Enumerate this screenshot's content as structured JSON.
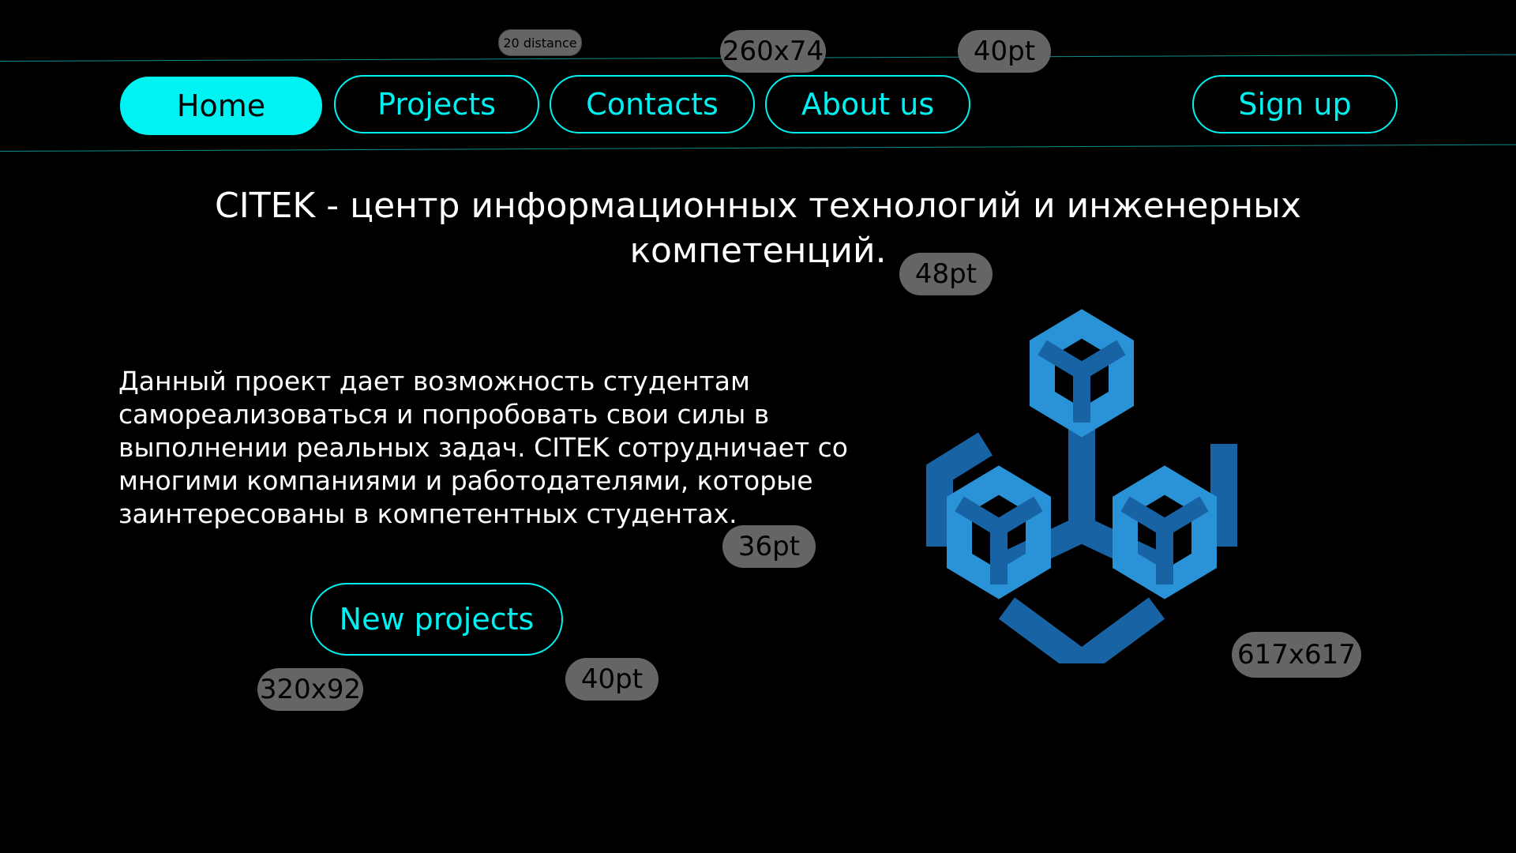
{
  "nav": {
    "items": [
      {
        "label": "Home"
      },
      {
        "label": "Projects"
      },
      {
        "label": "Contacts"
      },
      {
        "label": "About us"
      }
    ],
    "signup_label": "Sign up"
  },
  "hero": {
    "headline": "CITEK - центр информационных технологий и инженерных компетенций.",
    "body": "Данный проект дает возможность студентам самореализоваться и попробовать свои силы в выполнении реальных задач. CITEK сотрудничает со многими компаниями и работодателями, которые заинтересованы в компетентных студентах.",
    "cta_label": "New projects"
  },
  "annotations": {
    "distance": "20 distance",
    "nav_size": "260x74",
    "nav_font": "40pt",
    "headline_font": "48pt",
    "body_font": "36pt",
    "cta_size": "320x92",
    "cta_font": "40pt",
    "logo_size": "617x617"
  },
  "colors": {
    "accent": "#00f3f3",
    "logo_light": "#2a92d6",
    "logo_dark": "#1763a3",
    "annotation_bg": "#656565"
  },
  "logo": {
    "icon": "cubes-logo-icon"
  }
}
